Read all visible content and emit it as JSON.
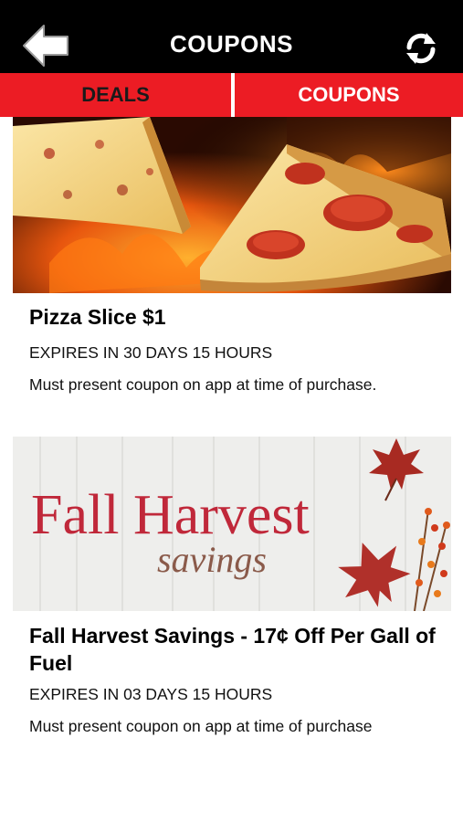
{
  "header": {
    "title": "COUPONS",
    "back_icon": "back-arrow-icon",
    "refresh_icon": "refresh-icon"
  },
  "tabs": [
    {
      "label": "DEALS",
      "active": false
    },
    {
      "label": "COUPONS",
      "active": true
    }
  ],
  "colors": {
    "accent": "#ec1c24",
    "header_bg": "#000000"
  },
  "coupons": [
    {
      "title": "Pizza Slice $1",
      "expiry": "EXPIRES IN 30 DAYS 15 HOURS",
      "terms": "Must present coupon on app at time of purchase."
    },
    {
      "title": "Fall Harvest Savings - 17¢ Off Per Gall of Fuel",
      "expiry": "EXPIRES IN 03 DAYS 15 HOURS",
      "terms": "Must present coupon on app at time of purchase",
      "image_text": {
        "headline": "Fall Harvest",
        "subline": "savings"
      }
    }
  ]
}
